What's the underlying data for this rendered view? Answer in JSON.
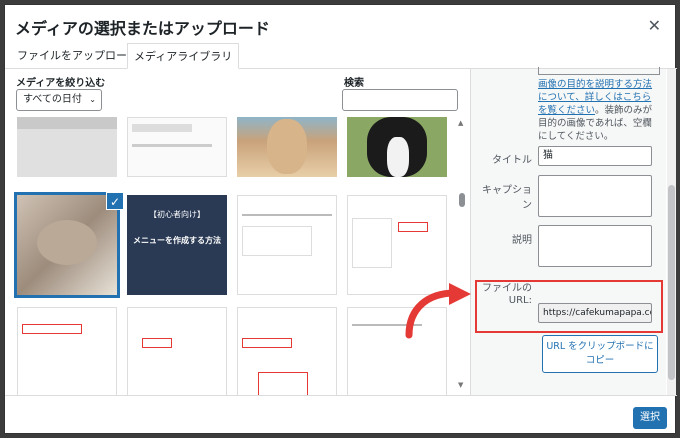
{
  "dialog": {
    "title": "メディアの選択またはアップロード",
    "close_icon": "close-icon"
  },
  "tabs": [
    {
      "label": "ファイルをアップロード",
      "active": false
    },
    {
      "label": "メディアライブラリ",
      "active": true
    }
  ],
  "filter": {
    "label": "メディアを絞り込む",
    "date_select": "すべての日付"
  },
  "search": {
    "label": "検索",
    "value": ""
  },
  "grid": {
    "items": [
      {
        "name": "thumb-screenshot-1",
        "kind": "screenshot"
      },
      {
        "name": "thumb-screenshot-2",
        "kind": "screenshot"
      },
      {
        "name": "thumb-rabbit",
        "kind": "photo"
      },
      {
        "name": "thumb-puppy",
        "kind": "photo"
      },
      {
        "name": "thumb-kitten",
        "kind": "photo",
        "selected": true
      },
      {
        "name": "thumb-menu-title",
        "kind": "graphic",
        "text_top": "【初心者向け】",
        "text_main": "メニューを作成する方法"
      },
      {
        "name": "thumb-screenshot-3",
        "kind": "screenshot"
      },
      {
        "name": "thumb-screenshot-4",
        "kind": "screenshot"
      },
      {
        "name": "thumb-screenshot-5",
        "kind": "screenshot"
      },
      {
        "name": "thumb-screenshot-6",
        "kind": "screenshot"
      },
      {
        "name": "thumb-screenshot-7",
        "kind": "screenshot"
      },
      {
        "name": "thumb-screenshot-8",
        "kind": "screenshot"
      }
    ]
  },
  "details": {
    "help_link": "画像の目的を説明する方法について、詳しくはこちらを覧ください",
    "help_rest": "。装飾のみが目的の画像であれば、空欄にしてください。",
    "title_label": "タイトル",
    "title_value": "猫",
    "caption_label": "キャプション",
    "description_label": "説明",
    "url_label": "ファイルの URL:",
    "url_value": "https://cafekumapapa.com",
    "copy_button": "URL をクリップボードにコピー"
  },
  "footer": {
    "select_button": "選択"
  },
  "colors": {
    "accent": "#2271b1",
    "highlight": "#e53935"
  }
}
